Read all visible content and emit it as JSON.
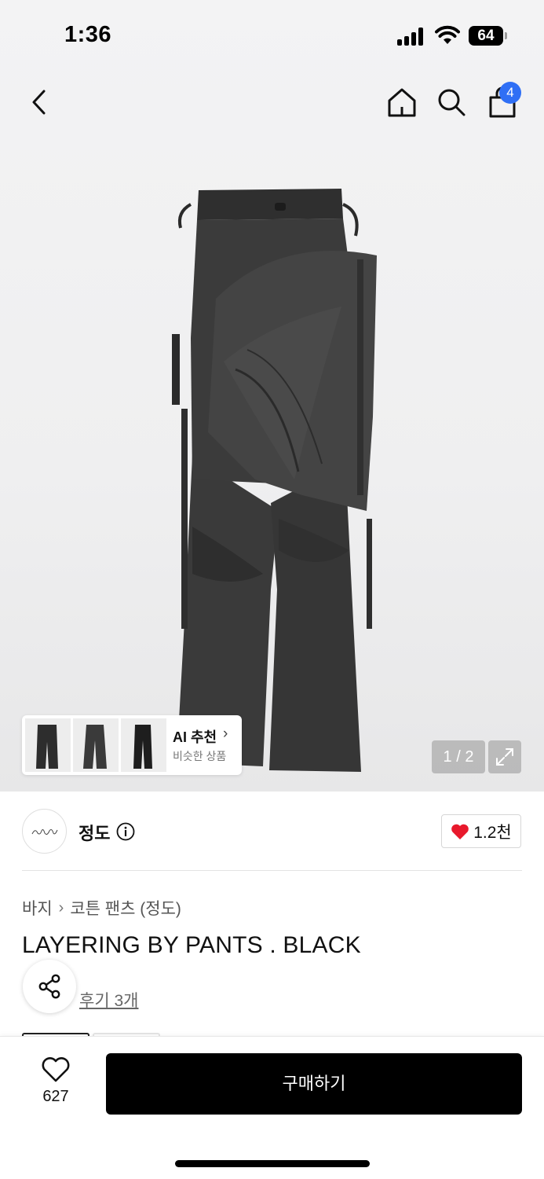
{
  "status_bar": {
    "time": "1:36",
    "battery": "64"
  },
  "nav": {
    "cart_badge": "4",
    "icons": [
      "chevron-left-icon",
      "home-icon",
      "search-icon",
      "shopping-bag-icon"
    ]
  },
  "gallery": {
    "page_indicator": "1 / 2",
    "ai_recommend": {
      "title": "AI 추천",
      "subtitle": "비슷한 상품"
    }
  },
  "brand": {
    "name": "정도",
    "like_count": "1.2천"
  },
  "breadcrumb": {
    "category": "바지",
    "subcategory": "코튼 팬츠 (정도)"
  },
  "product": {
    "title": "LAYERING BY PANTS . BLACK",
    "review_link": "후기 3개"
  },
  "bottom": {
    "wish_count": "627",
    "buy_label": "구매하기"
  },
  "colors": {
    "badge": "#2f6ff5",
    "heart": "#e8192c",
    "buy_button": "#000000"
  }
}
